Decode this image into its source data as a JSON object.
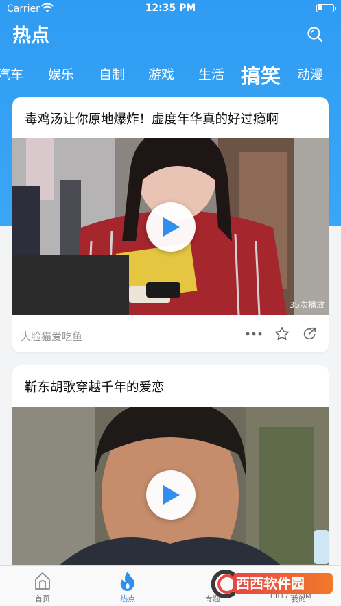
{
  "status_bar": {
    "carrier": "Carrier",
    "time": "12:35 PM"
  },
  "header": {
    "title": "热点"
  },
  "tabs": [
    {
      "label": "汽车",
      "active": false
    },
    {
      "label": "娱乐",
      "active": false
    },
    {
      "label": "自制",
      "active": false
    },
    {
      "label": "游戏",
      "active": false
    },
    {
      "label": "生活",
      "active": false
    },
    {
      "label": "搞笑",
      "active": true
    },
    {
      "label": "动漫",
      "active": false
    }
  ],
  "cards": [
    {
      "title": "毒鸡汤让你原地爆炸！虚度年华真的好过瘾啊",
      "author": "大脸猫爱吃鱼",
      "play_count": "35次播放"
    },
    {
      "title": "靳东胡歌穿越千年的爱恋"
    }
  ],
  "tabbar": [
    {
      "label": "首页",
      "icon": "home-icon",
      "active": false
    },
    {
      "label": "热点",
      "icon": "flame-icon",
      "active": true
    },
    {
      "label": "专题",
      "icon": "topic-icon",
      "active": false
    },
    {
      "label": "我的",
      "icon": "profile-icon",
      "active": false
    }
  ],
  "watermark": {
    "text": "西西软件园",
    "sub": "CR173.COM"
  },
  "colors": {
    "primary": "#2f9cf3",
    "active_tab": "#2f8ff0",
    "play_icon": "#2f8ff0"
  }
}
